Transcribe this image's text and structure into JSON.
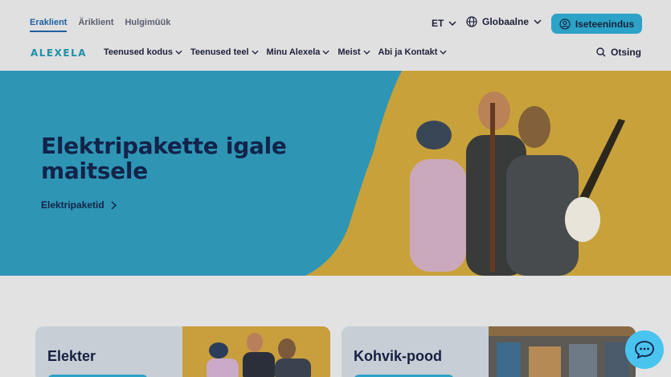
{
  "segments": [
    {
      "label": "Eraklient",
      "active": true
    },
    {
      "label": "Äriklient",
      "active": false
    },
    {
      "label": "Hulgimüük",
      "active": false
    }
  ],
  "language": "ET",
  "region": "Globaalne",
  "self_service": "Iseteenindus",
  "logo": "ALEXELA",
  "nav": [
    {
      "label": "Teenused kodus"
    },
    {
      "label": "Teenused teel"
    },
    {
      "label": "Minu Alexela"
    },
    {
      "label": "Meist"
    },
    {
      "label": "Abi ja Kontakt"
    }
  ],
  "search_label": "Otsing",
  "hero": {
    "title_line1": "Elektripakette igale",
    "title_line2": "maitsele",
    "link": "Elektripaketid"
  },
  "cards": [
    {
      "title": "Elekter"
    },
    {
      "title": "Kohvik-pood"
    }
  ],
  "colors": {
    "accent": "#2ca2c6",
    "hero_blue": "#2e95b5",
    "hero_yellow": "#c9a13a",
    "text_dark": "#132349"
  }
}
